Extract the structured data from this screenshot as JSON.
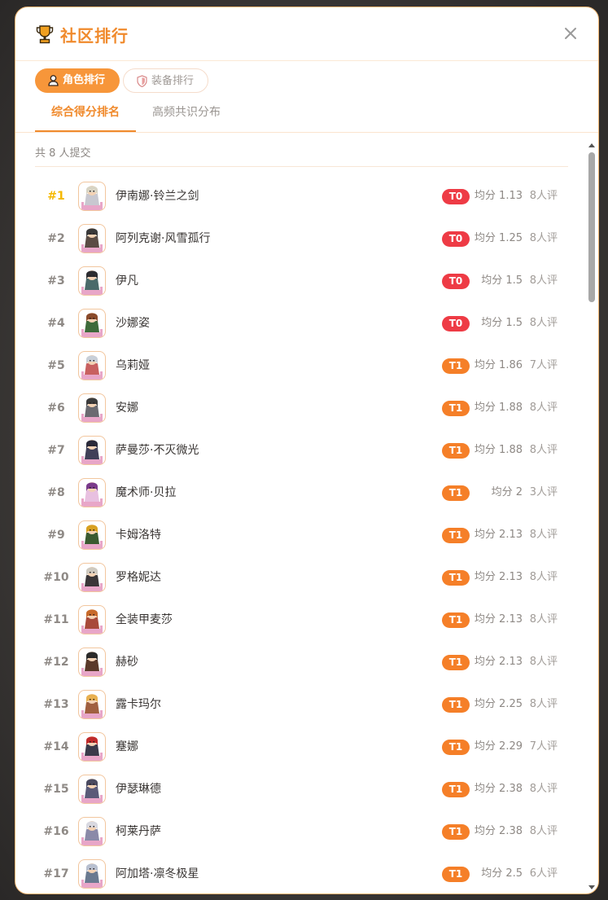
{
  "modal": {
    "title": "社区排行",
    "title_icon": "trophy-icon",
    "close_icon": "close-icon"
  },
  "toggle": {
    "active_label": "角色排行",
    "active_icon": "person-icon",
    "inactive_label": "装备排行",
    "inactive_icon": "shield-icon"
  },
  "tabs": {
    "active": "综合得分排名",
    "inactive": "高频共识分布"
  },
  "summary": "共 8 人提交",
  "colors": {
    "accent": "#f08a2c",
    "t0": "#ee3b45",
    "t1": "#f57f28",
    "gold_rank": "#f5b800"
  },
  "rows": [
    {
      "rank": "#1",
      "name": "伊南娜·铃兰之剑",
      "tier": "T0",
      "score": "均分 1.13",
      "votes": "8人评",
      "hair": "#d8d4c4",
      "cloth": "#c8c8d0"
    },
    {
      "rank": "#2",
      "name": "阿列克谢·风雪孤行",
      "tier": "T0",
      "score": "均分 1.25",
      "votes": "8人评",
      "hair": "#3a3a3a",
      "cloth": "#5a4c44"
    },
    {
      "rank": "#3",
      "name": "伊凡",
      "tier": "T0",
      "score": "均分 1.5",
      "votes": "8人评",
      "hair": "#2c2c30",
      "cloth": "#4a6a6a"
    },
    {
      "rank": "#4",
      "name": "沙娜姿",
      "tier": "T0",
      "score": "均分 1.5",
      "votes": "8人评",
      "hair": "#8a4a2a",
      "cloth": "#3e6a3a"
    },
    {
      "rank": "#5",
      "name": "乌莉娅",
      "tier": "T1",
      "score": "均分 1.86",
      "votes": "7人评",
      "hair": "#c8cfd8",
      "cloth": "#c86060"
    },
    {
      "rank": "#6",
      "name": "安娜",
      "tier": "T1",
      "score": "均分 1.88",
      "votes": "8人评",
      "hair": "#3c3c3c",
      "cloth": "#6a6a70"
    },
    {
      "rank": "#7",
      "name": "萨曼莎·不灭微光",
      "tier": "T1",
      "score": "均分 1.88",
      "votes": "8人评",
      "hair": "#2a2a3a",
      "cloth": "#404058"
    },
    {
      "rank": "#8",
      "name": "魔术师·贝拉",
      "tier": "T1",
      "score": "均分 2",
      "votes": "3人评",
      "hair": "#7a3a8a",
      "cloth": "#e8c0e0"
    },
    {
      "rank": "#9",
      "name": "卡姆洛特",
      "tier": "T1",
      "score": "均分 2.13",
      "votes": "8人评",
      "hair": "#d8a020",
      "cloth": "#3a5a30"
    },
    {
      "rank": "#10",
      "name": "罗格妮达",
      "tier": "T1",
      "score": "均分 2.13",
      "votes": "8人评",
      "hair": "#cfcac0",
      "cloth": "#3a3638"
    },
    {
      "rank": "#11",
      "name": "全装甲麦莎",
      "tier": "T1",
      "score": "均分 2.13",
      "votes": "8人评",
      "hair": "#c86a2a",
      "cloth": "#a84a3a"
    },
    {
      "rank": "#12",
      "name": "赫砂",
      "tier": "T1",
      "score": "均分 2.13",
      "votes": "8人评",
      "hair": "#2a2a2a",
      "cloth": "#5a3a2a"
    },
    {
      "rank": "#13",
      "name": "露卡玛尔",
      "tier": "T1",
      "score": "均分 2.25",
      "votes": "8人评",
      "hair": "#e8b050",
      "cloth": "#a06040"
    },
    {
      "rank": "#14",
      "name": "蹇娜",
      "tier": "T1",
      "score": "均分 2.29",
      "votes": "7人评",
      "hair": "#c02a2a",
      "cloth": "#3a3a4a"
    },
    {
      "rank": "#15",
      "name": "伊瑟琳德",
      "tier": "T1",
      "score": "均分 2.38",
      "votes": "8人评",
      "hair": "#4a4a60",
      "cloth": "#5a5a78"
    },
    {
      "rank": "#16",
      "name": "柯莱丹萨",
      "tier": "T1",
      "score": "均分 2.38",
      "votes": "8人评",
      "hair": "#d8d8e0",
      "cloth": "#8a8aa8"
    },
    {
      "rank": "#17",
      "name": "阿加塔·凛冬极星",
      "tier": "T1",
      "score": "均分 2.5",
      "votes": "6人评",
      "hair": "#b8c0d0",
      "cloth": "#6a7a90"
    }
  ]
}
